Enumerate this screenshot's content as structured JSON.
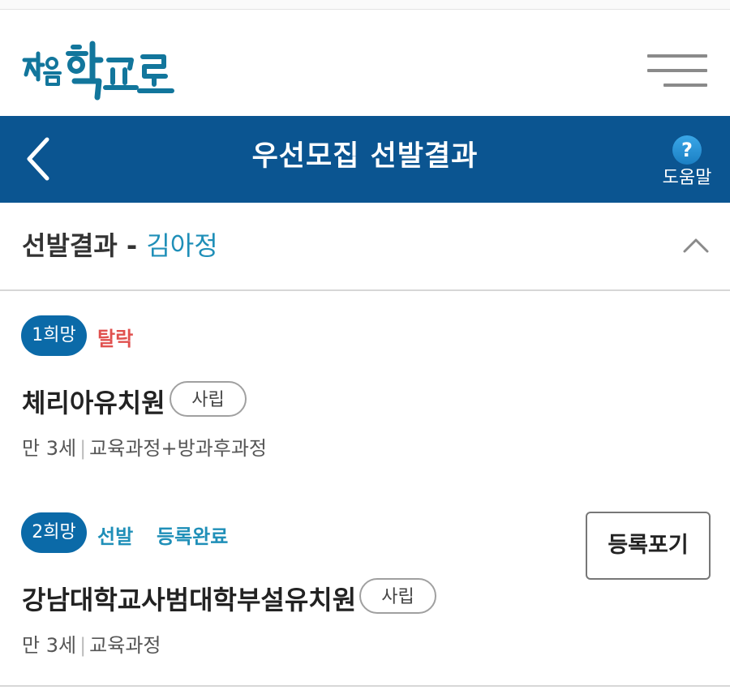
{
  "header": {
    "logo_text": "처음학교로",
    "menu_icon": "hamburger-menu-icon"
  },
  "navbar": {
    "back_icon": "chevron-left-icon",
    "title": "우선모집 선발결과",
    "help_icon_glyph": "?",
    "help_label": "도움말"
  },
  "section": {
    "title": "선발결과",
    "dash": "-",
    "applicant_name": "김아정",
    "collapse_icon": "chevron-up-icon"
  },
  "results": [
    {
      "rank_label": "1희망",
      "status": "탈락",
      "status_color": "#e0504e",
      "name": "체리아유치원",
      "type": "사립",
      "age": "만 3세",
      "course": "교육과정+방과후과정"
    },
    {
      "rank_label": "2희망",
      "status": "선발",
      "sub_status": "등록완료",
      "status_color": "#1f8fb8",
      "name": "강남대학교사범대학부설유치원",
      "type": "사립",
      "age": "만 3세",
      "course": "교육과정",
      "action_label": "등록포기"
    }
  ],
  "colors": {
    "navbar": "#0b5591",
    "badge": "#0b6aa8",
    "accent": "#1f8fb8",
    "fail": "#e0504e"
  }
}
